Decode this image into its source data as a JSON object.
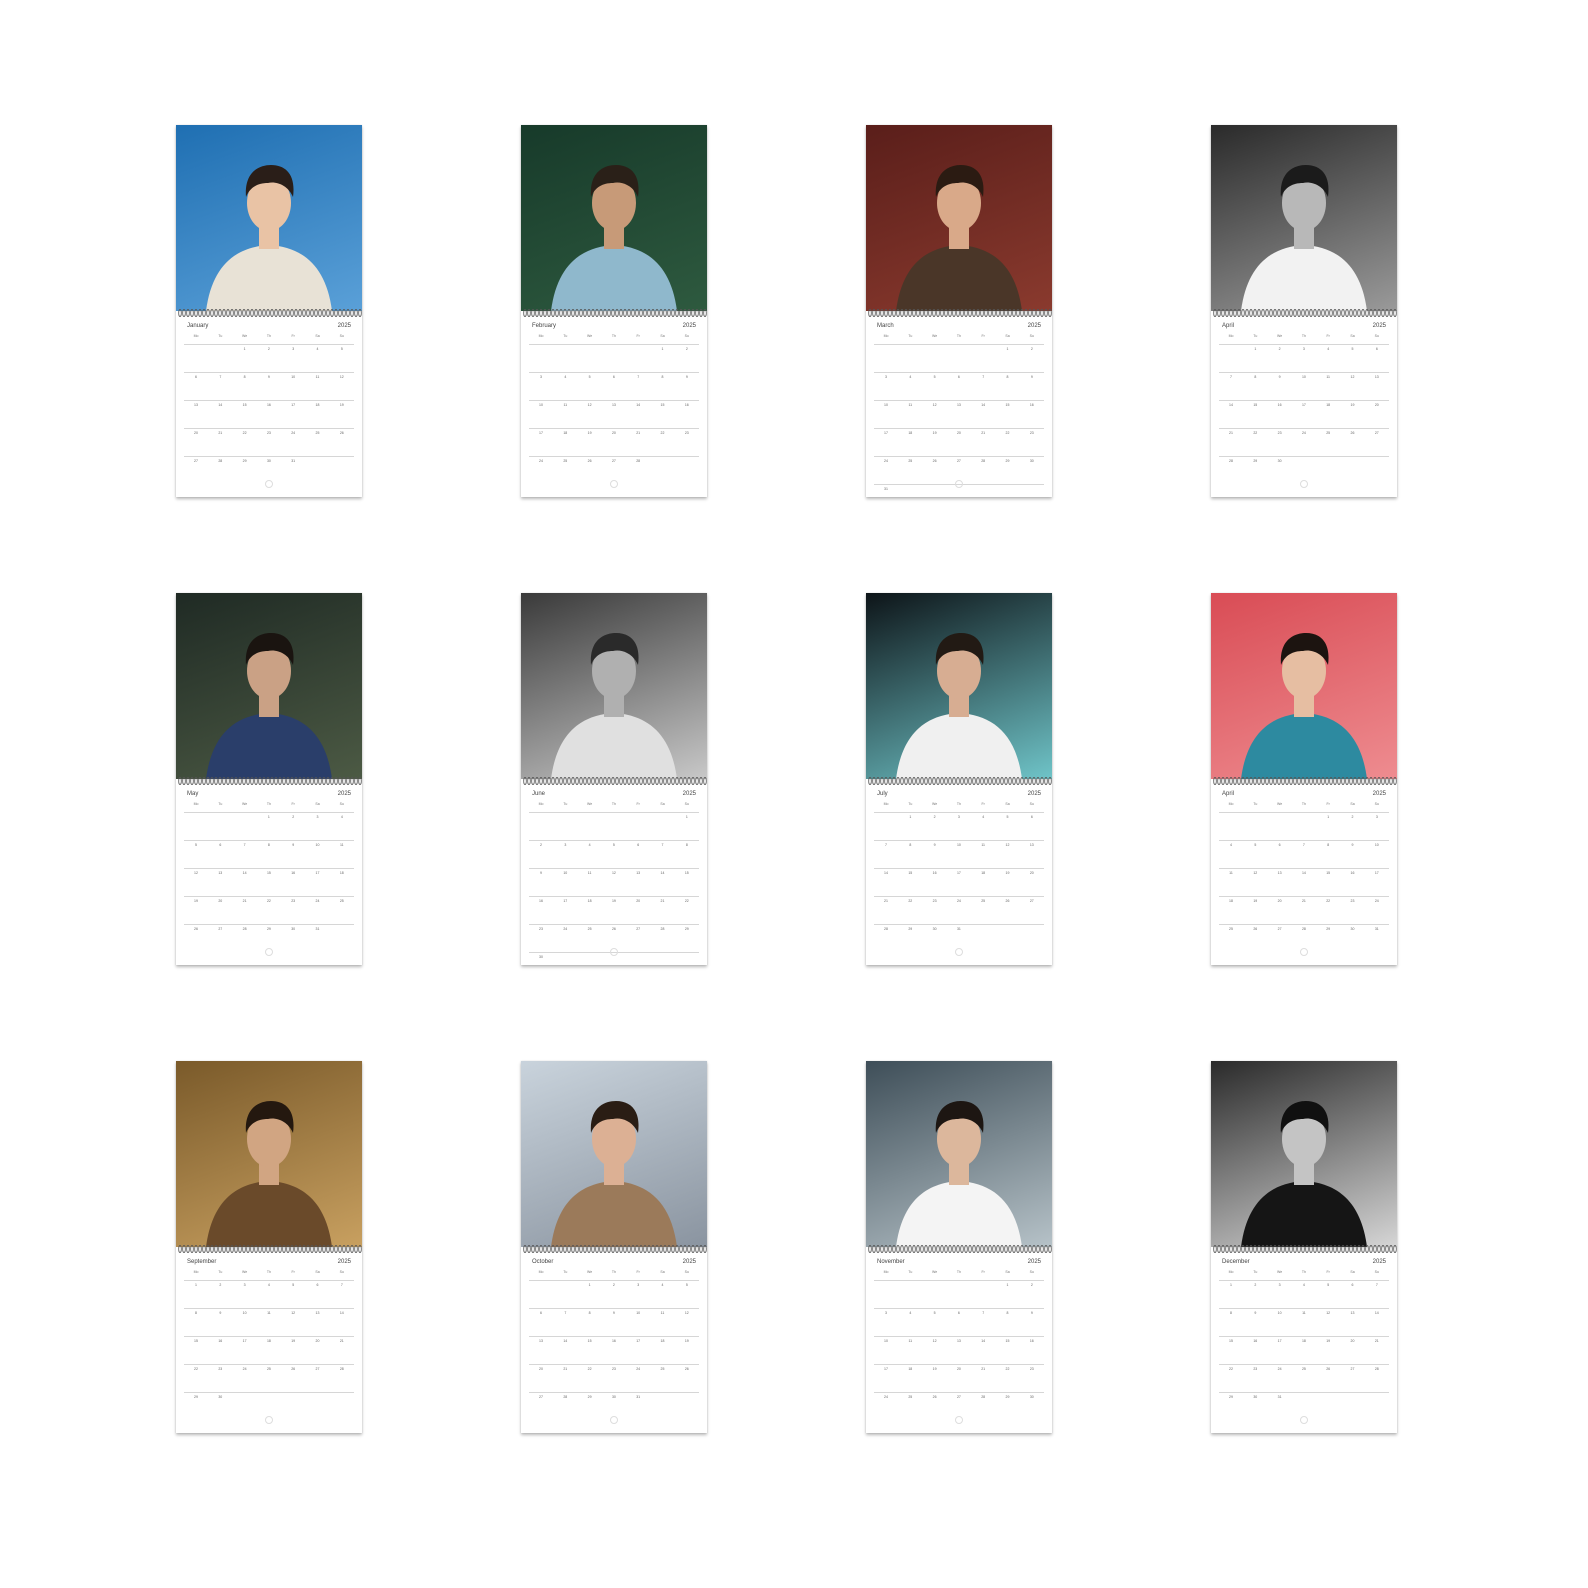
{
  "weekdays": [
    "Mo",
    "Tu",
    "We",
    "Th",
    "Fr",
    "Sa",
    "Su"
  ],
  "calendars": [
    {
      "month": "January",
      "year": "2025",
      "start": 2,
      "days": 31,
      "bg": [
        "#1f6fb2",
        "#5aa0d8"
      ],
      "tone": "color",
      "skin": "#e9c3a5",
      "shirt": "#e8e2d6",
      "hair": "#2a1e18"
    },
    {
      "month": "February",
      "year": "2025",
      "start": 5,
      "days": 28,
      "bg": [
        "#173a2a",
        "#2e5a3f"
      ],
      "tone": "color",
      "skin": "#c79a78",
      "shirt": "#8fb8cc",
      "hair": "#2a2018"
    },
    {
      "month": "March",
      "year": "2025",
      "start": 5,
      "days": 31,
      "bg": [
        "#5a1e1a",
        "#8a3a2e"
      ],
      "tone": "color",
      "skin": "#d9a989",
      "shirt": "#4a3628",
      "hair": "#2b1b12"
    },
    {
      "month": "April",
      "year": "2025",
      "start": 1,
      "days": 30,
      "bg": [
        "#2a2a2a",
        "#9a9a9a"
      ],
      "tone": "bw",
      "skin": "#b8b8b8",
      "shirt": "#f2f2f2",
      "hair": "#1b1b1b"
    },
    {
      "month": "May",
      "year": "2025",
      "start": 3,
      "days": 31,
      "bg": [
        "#1f2a24",
        "#4c5a44"
      ],
      "tone": "color",
      "skin": "#caa185",
      "shirt": "#2a3e6a",
      "hair": "#1a1410"
    },
    {
      "month": "June",
      "year": "2025",
      "start": 6,
      "days": 30,
      "bg": [
        "#3a3a3a",
        "#c8c8c8"
      ],
      "tone": "bw",
      "skin": "#b0b0b0",
      "shirt": "#e0e0e0",
      "hair": "#2a2a2a"
    },
    {
      "month": "July",
      "year": "2025",
      "start": 1,
      "days": 31,
      "bg": [
        "#0d1418",
        "#6fc4c8"
      ],
      "tone": "color",
      "skin": "#d7ad92",
      "shirt": "#f0f0f0",
      "hair": "#221a14"
    },
    {
      "month": "April",
      "year": "2025",
      "start": 4,
      "days": 31,
      "bg": [
        "#d94c55",
        "#ee8c90"
      ],
      "tone": "color",
      "skin": "#e6bea2",
      "shirt": "#2d8aa0",
      "hair": "#1c1410"
    },
    {
      "month": "September",
      "year": "2025",
      "start": 0,
      "days": 30,
      "bg": [
        "#7a5a2a",
        "#c8a060"
      ],
      "tone": "color",
      "skin": "#d1a582",
      "shirt": "#6a4a2a",
      "hair": "#24180f"
    },
    {
      "month": "October",
      "year": "2025",
      "start": 2,
      "days": 31,
      "bg": [
        "#c9d3dc",
        "#8a94a0"
      ],
      "tone": "color",
      "skin": "#dcb094",
      "shirt": "#9b7a5a",
      "hair": "#2a1d14"
    },
    {
      "month": "November",
      "year": "2025",
      "start": 5,
      "days": 30,
      "bg": [
        "#3e4e58",
        "#b6c2c8"
      ],
      "tone": "color",
      "skin": "#dcb79c",
      "shirt": "#f4f4f4",
      "hair": "#1d1612"
    },
    {
      "month": "December",
      "year": "2025",
      "start": 0,
      "days": 31,
      "bg": [
        "#2a2a2a",
        "#d6d6d6"
      ],
      "tone": "bw",
      "skin": "#c4c4c4",
      "shirt": "#151515",
      "hair": "#101010"
    }
  ]
}
